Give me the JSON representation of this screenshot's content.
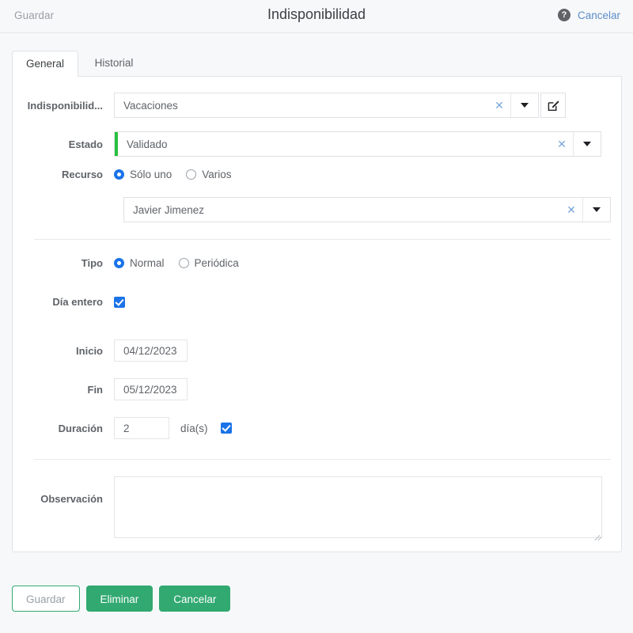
{
  "header": {
    "save_label": "Guardar",
    "title": "Indisponibilidad",
    "help_icon": "help-circle-icon",
    "cancel_label": "Cancelar"
  },
  "tabs": [
    {
      "label": "General",
      "active": true
    },
    {
      "label": "Historial",
      "active": false
    }
  ],
  "form": {
    "unavailability": {
      "label": "Indisponibilid...",
      "value": "Vacaciones",
      "clear_icon": "clear-x-icon",
      "caret_icon": "chevron-down-icon",
      "edit_icon": "pencil-square-icon"
    },
    "status": {
      "label": "Estado",
      "value": "Validado",
      "accent_color": "#27c13f",
      "clear_icon": "clear-x-icon",
      "caret_icon": "chevron-down-icon"
    },
    "resource": {
      "label": "Recurso",
      "options": [
        {
          "label": "Sólo uno",
          "checked": true
        },
        {
          "label": "Varios",
          "checked": false
        }
      ],
      "value": "Javier Jimenez",
      "clear_icon": "clear-x-icon",
      "caret_icon": "chevron-down-icon"
    },
    "type": {
      "label": "Tipo",
      "options": [
        {
          "label": "Normal",
          "checked": true
        },
        {
          "label": "Periódica",
          "checked": false
        }
      ]
    },
    "full_day": {
      "label": "Día entero",
      "checked": true
    },
    "start": {
      "label": "Inicio",
      "value": "04/12/2023"
    },
    "end": {
      "label": "Fin",
      "value": "05/12/2023"
    },
    "duration": {
      "label": "Duración",
      "value": "2",
      "unit": "día(s)",
      "checked": true
    },
    "observation": {
      "label": "Observación",
      "value": "",
      "placeholder": ""
    }
  },
  "footer": {
    "save_label": "Guardar",
    "delete_label": "Eliminar",
    "cancel_label": "Cancelar",
    "primary_color": "#31a971"
  }
}
